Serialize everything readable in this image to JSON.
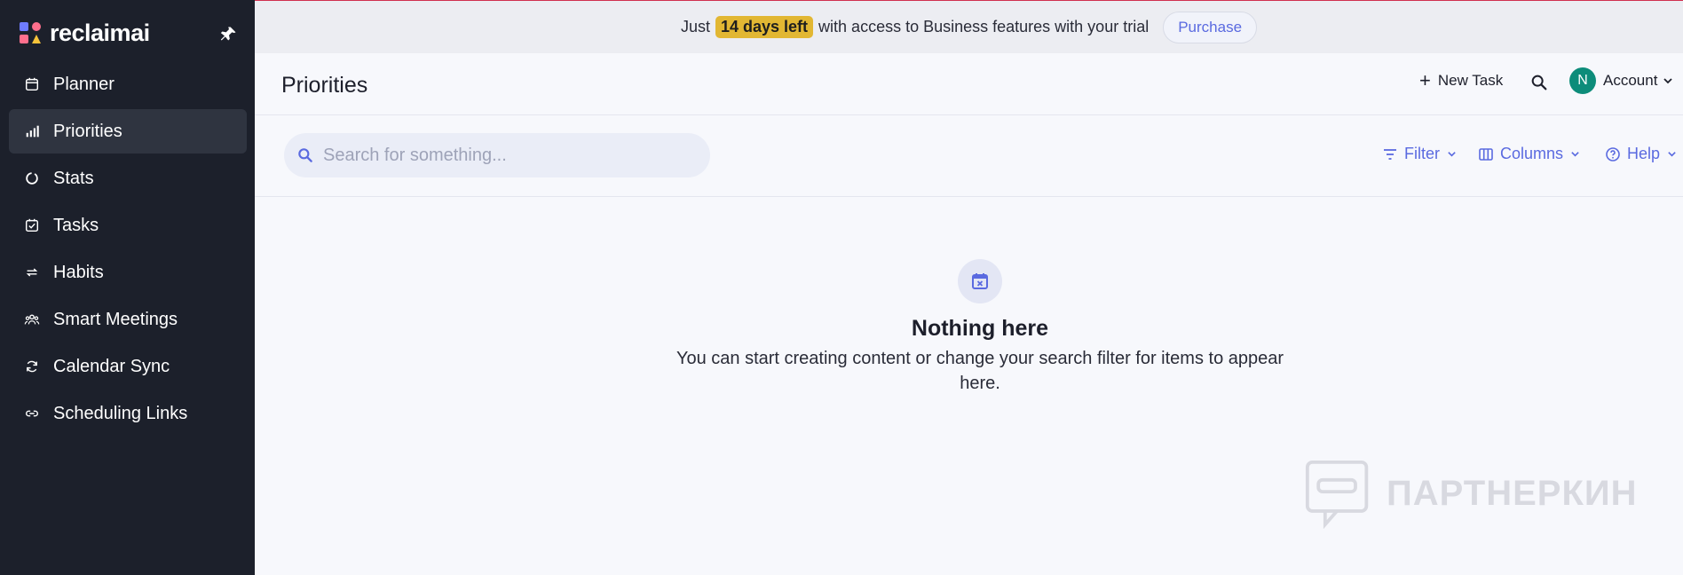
{
  "brand": {
    "name": "reclaimai"
  },
  "sidebar": {
    "items": [
      {
        "label": "Planner",
        "icon": "calendar-icon"
      },
      {
        "label": "Priorities",
        "icon": "bar-chart-icon",
        "active": true
      },
      {
        "label": "Stats",
        "icon": "stats-ring-icon"
      },
      {
        "label": "Tasks",
        "icon": "checkbox-icon"
      },
      {
        "label": "Habits",
        "icon": "repeat-icon"
      },
      {
        "label": "Smart Meetings",
        "icon": "people-icon"
      },
      {
        "label": "Calendar Sync",
        "icon": "sync-icon"
      },
      {
        "label": "Scheduling Links",
        "icon": "link-icon"
      }
    ]
  },
  "banner": {
    "prefix": "Just",
    "days_left": "14 days left",
    "suffix": "with access to Business features with your trial",
    "purchase_label": "Purchase"
  },
  "header": {
    "title": "Priorities",
    "new_task_label": "New Task",
    "account_initial": "N",
    "account_label": "Account"
  },
  "toolbar": {
    "search_placeholder": "Search for something...",
    "filter_label": "Filter",
    "columns_label": "Columns",
    "help_label": "Help"
  },
  "empty_state": {
    "title": "Nothing here",
    "text": "You can start creating content or change your search filter for items to appear here."
  },
  "watermark": {
    "text": "ПАРТНЕРКИН"
  },
  "colors": {
    "sidebar_bg": "#1c202b",
    "accent": "#5a6ae0",
    "badge": "#e2b733",
    "avatar": "#0d8c7a"
  }
}
